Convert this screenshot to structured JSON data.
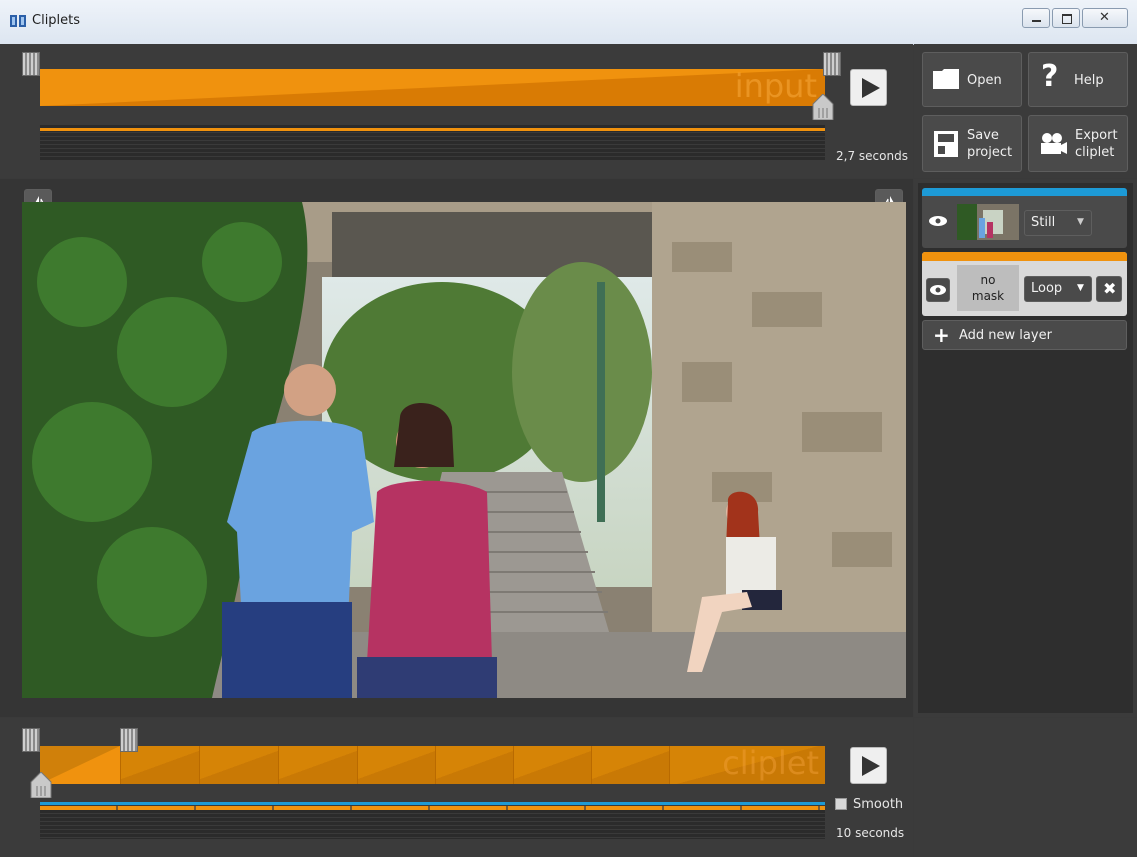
{
  "window": {
    "title": "Cliplets"
  },
  "input_timeline": {
    "watermark": "input",
    "duration": "2,7 seconds"
  },
  "cliplet_timeline": {
    "watermark": "cliplet",
    "smooth_label": "Smooth",
    "duration": "10 seconds"
  },
  "toolbar": {
    "open_label": "Open",
    "help_label": "Help",
    "save_label_line1": "Save",
    "save_label_line2": "project",
    "export_label_line1": "Export",
    "export_label_line2": "cliplet"
  },
  "layers": {
    "still_layer": {
      "mode": "Still"
    },
    "loop_layer": {
      "mask_line1": "no",
      "mask_line2": "mask",
      "mode": "Loop"
    },
    "add_layer_label": "Add new layer"
  },
  "colors": {
    "accent_orange": "#f0920e",
    "accent_blue": "#1d9ad6",
    "panel_bg": "#3b3b3b"
  }
}
